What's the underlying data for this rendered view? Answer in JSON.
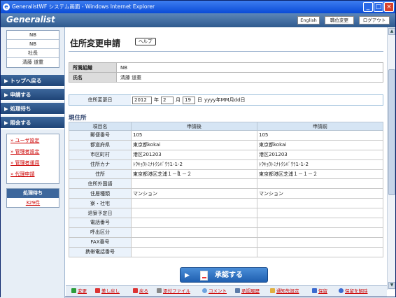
{
  "window": {
    "title": "GeneralistWF システム画面 - Windows Internet Explorer"
  },
  "header": {
    "logo": "Generalist",
    "buttons": [
      "English",
      "職位変更",
      "ログアウト"
    ]
  },
  "sidebar": {
    "user_info": [
      "NB",
      "NB",
      "社長",
      "清藤 道重"
    ],
    "nav": [
      "トップへ戻る",
      "申請する",
      "処理待ち",
      "照会する"
    ],
    "links": [
      "ユーザ設定",
      "管理者設定",
      "管理者運用",
      "代理申請"
    ],
    "pending": {
      "label": "処理待ち",
      "count": "329件"
    }
  },
  "page": {
    "title": "住所変更申請",
    "help": "ヘルプ"
  },
  "info": {
    "org_label": "所属組織",
    "org_value": "NB",
    "name_label": "氏名",
    "name_value": "清藤 道重"
  },
  "date": {
    "label": "住所変更日",
    "year": "2012",
    "year_unit": "年",
    "month": "2",
    "month_unit": "月",
    "day": "19",
    "day_unit": "日",
    "format": "yyyy年MM月dd日"
  },
  "address": {
    "section_title": "現住所",
    "headers": [
      "項目名",
      "申請後",
      "申請前"
    ],
    "rows": [
      {
        "label": "郵便番号",
        "after": "105",
        "before": "105"
      },
      {
        "label": "都道府県",
        "after": "東京都kokai",
        "before": "東京都kokai"
      },
      {
        "label": "市区町村",
        "after": "港区201203",
        "before": "港区201203"
      },
      {
        "label": "住所カナ",
        "after": "ﾄｳｷｮｳﾄﾐﾅﾄｸｼﾊﾞｳﾗ1-1-2",
        "before": "ﾄｳｷｮｳﾄﾐﾅﾄｸｼﾊﾞｳﾗ1-1-2"
      },
      {
        "label": "住所",
        "after": "東京都港区芝浦１－１－２",
        "before": "東京都港区芝浦１－１－２"
      },
      {
        "label": "住所外国語",
        "after": "",
        "before": ""
      },
      {
        "label": "住居種類",
        "after": "マンション",
        "before": "マンション"
      },
      {
        "label": "寮・社宅",
        "after": "",
        "before": ""
      },
      {
        "label": "退寮予定日",
        "after": "",
        "before": ""
      },
      {
        "label": "電話番号",
        "after": "",
        "before": ""
      },
      {
        "label": "呼出区分",
        "after": "",
        "before": ""
      },
      {
        "label": "FAX番号",
        "after": "",
        "before": ""
      },
      {
        "label": "携帯電話番号",
        "after": "",
        "before": ""
      }
    ]
  },
  "approve": {
    "label": "承認する"
  },
  "footer": {
    "items": [
      "変更",
      "差し戻し",
      "戻る",
      "添付ファイル",
      "コメント",
      "承認履歴",
      "通知先設定",
      "保留",
      "保留を解除"
    ]
  },
  "colors": {
    "header": "#2f5a8e",
    "nav": "#1f4577",
    "link": "#c00000",
    "table_header": "#d6e5f4"
  }
}
